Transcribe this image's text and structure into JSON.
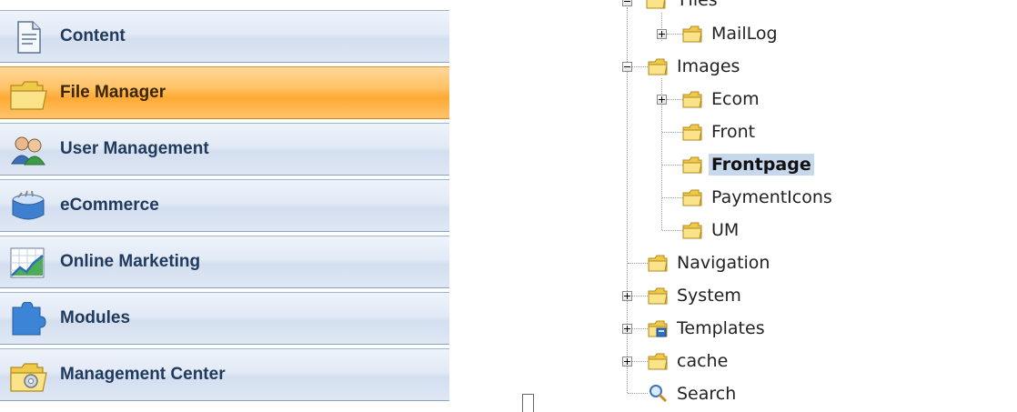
{
  "nav": {
    "items": [
      {
        "label": "Content",
        "icon": "content-page-icon"
      },
      {
        "label": "File Manager",
        "icon": "folder-icon",
        "active": true
      },
      {
        "label": "User Management",
        "icon": "users-icon"
      },
      {
        "label": "eCommerce",
        "icon": "shopping-basket-icon"
      },
      {
        "label": "Online Marketing",
        "icon": "marketing-chart-icon"
      },
      {
        "label": "Modules",
        "icon": "puzzle-icon"
      },
      {
        "label": "Management Center",
        "icon": "gear-folder-icon"
      }
    ],
    "active_color": "#ffa934",
    "item_color": "#dfe7f4"
  },
  "tree": {
    "nodes": [
      {
        "label": "Files",
        "expander": "minus",
        "icon": "folder-icon"
      },
      {
        "label": "MailLog",
        "expander": "plus",
        "icon": "folder-icon"
      },
      {
        "label": "Images",
        "expander": "minus",
        "icon": "folder-icon"
      },
      {
        "label": "Ecom",
        "expander": "plus",
        "icon": "folder-icon"
      },
      {
        "label": "Front",
        "expander": "none",
        "icon": "folder-icon"
      },
      {
        "label": "Frontpage",
        "expander": "none",
        "icon": "folder-icon",
        "selected": true
      },
      {
        "label": "PaymentIcons",
        "expander": "none",
        "icon": "folder-icon"
      },
      {
        "label": "UM",
        "expander": "none",
        "icon": "folder-icon"
      },
      {
        "label": "Navigation",
        "expander": "none",
        "icon": "folder-icon"
      },
      {
        "label": "System",
        "expander": "plus",
        "icon": "folder-icon"
      },
      {
        "label": "Templates",
        "expander": "plus",
        "icon": "template-folder-icon"
      },
      {
        "label": "cache",
        "expander": "plus",
        "icon": "folder-icon"
      },
      {
        "label": "Search",
        "expander": "none",
        "icon": "search-icon"
      }
    ],
    "selected_color": "#c7d7ec"
  }
}
